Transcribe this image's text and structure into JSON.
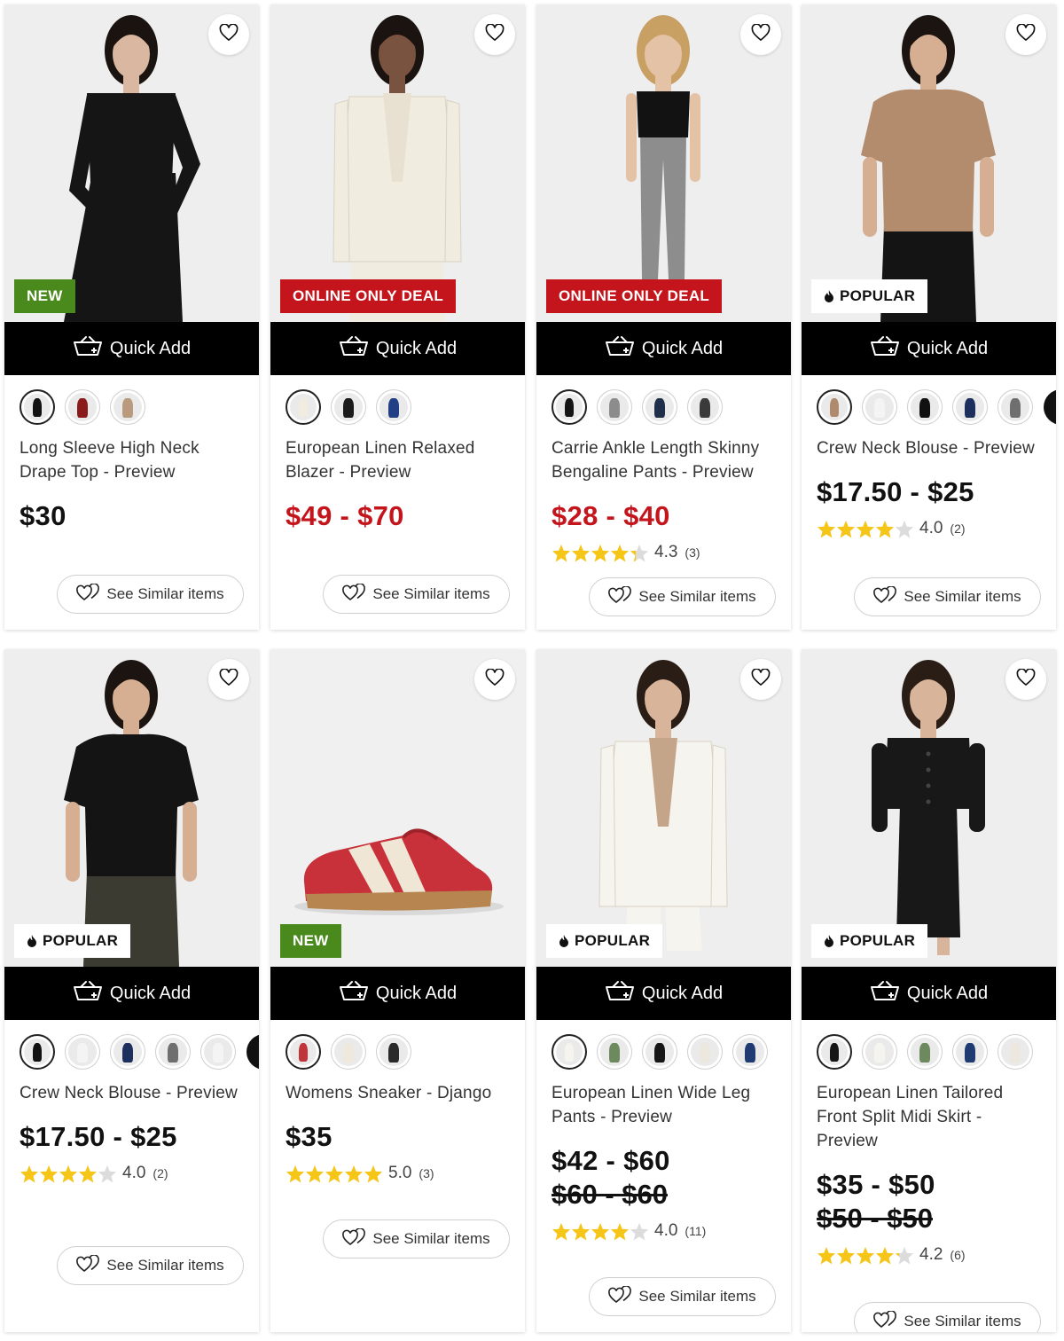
{
  "labels": {
    "quick_add": "Quick Add",
    "see_similar": "See Similar items"
  },
  "icons": {
    "wishlist": "heart-outline-icon",
    "quick_add": "shopping-basket-icon",
    "similar": "double-heart-icon",
    "popular": "flame-icon",
    "rating": "star-icon"
  },
  "colors": {
    "badge_new": "#4a8a1c",
    "badge_deal": "#c4141c",
    "price_sale": "#c4141c",
    "star": "#f5c518"
  },
  "products": [
    {
      "name": "Long Sleeve High Neck Drape Top - Preview",
      "badge": "NEW",
      "price": "$30",
      "price_sale": false,
      "swatches": [
        "#111111",
        "#8b1a1a",
        "#b99a7e"
      ],
      "more_swatches": false
    },
    {
      "name": "European Linen Relaxed Blazer - Preview",
      "badge": "ONLINE ONLY DEAL",
      "price": "$49 - $70",
      "price_sale": true,
      "swatches": [
        "#f1ece0",
        "#1a1a1a",
        "#203f84"
      ],
      "more_swatches": false
    },
    {
      "name": "Carrie Ankle Length Skinny Bengaline Pants - Preview",
      "badge": "ONLINE ONLY DEAL",
      "price": "$28 - $40",
      "price_sale": true,
      "rating": 4.3,
      "rating_value": "4.3",
      "rating_count": "(3)",
      "swatches": [
        "#151515",
        "#8c8c8c",
        "#1f2f4a",
        "#3a3a3a"
      ],
      "more_swatches": false
    },
    {
      "name": "Crew Neck Blouse - Preview",
      "badge": "POPULAR",
      "price": "$17.50 - $25",
      "price_sale": false,
      "rating": 4.0,
      "rating_value": "4.0",
      "rating_count": "(2)",
      "swatches": [
        "#b08a6c",
        "#f4f4f4",
        "#111111",
        "#1d2f5c",
        "#6f6f6f"
      ],
      "more_swatches": true
    },
    {
      "name": "Crew Neck Blouse - Preview",
      "badge": "POPULAR",
      "price": "$17.50 - $25",
      "price_sale": false,
      "rating": 4.0,
      "rating_value": "4.0",
      "rating_count": "(2)",
      "swatches": [
        "#111111",
        "#f4f4f4",
        "#1d2f5c",
        "#6f6f6f",
        "#f4f4f4"
      ],
      "more_swatches": true
    },
    {
      "name": "Womens Sneaker - Django",
      "badge": "NEW",
      "price": "$35",
      "price_sale": false,
      "rating": 5.0,
      "rating_value": "5.0",
      "rating_count": "(3)",
      "swatches": [
        "#c0353a",
        "#efe8dc",
        "#2a2a2a"
      ],
      "more_swatches": false
    },
    {
      "name": "European Linen Wide Leg Pants - Preview",
      "badge": "POPULAR",
      "price": "$42 - $60",
      "price_old": "$60 - $60",
      "price_sale": false,
      "rating": 4.0,
      "rating_value": "4.0",
      "rating_count": "(11)",
      "swatches": [
        "#f6f4ee",
        "#6c8a5e",
        "#161616",
        "#ece8df",
        "#203a72"
      ],
      "more_swatches": false
    },
    {
      "name": "European Linen Tailored Front Split Midi Skirt - Preview",
      "badge": "POPULAR",
      "price": "$35 - $50",
      "price_old": "$50 - $50",
      "price_sale": false,
      "rating": 4.2,
      "rating_value": "4.2",
      "rating_count": "(6)",
      "swatches": [
        "#161616",
        "#f6f4ee",
        "#6c8a5e",
        "#203a72",
        "#ece8df"
      ],
      "more_swatches": false
    }
  ]
}
